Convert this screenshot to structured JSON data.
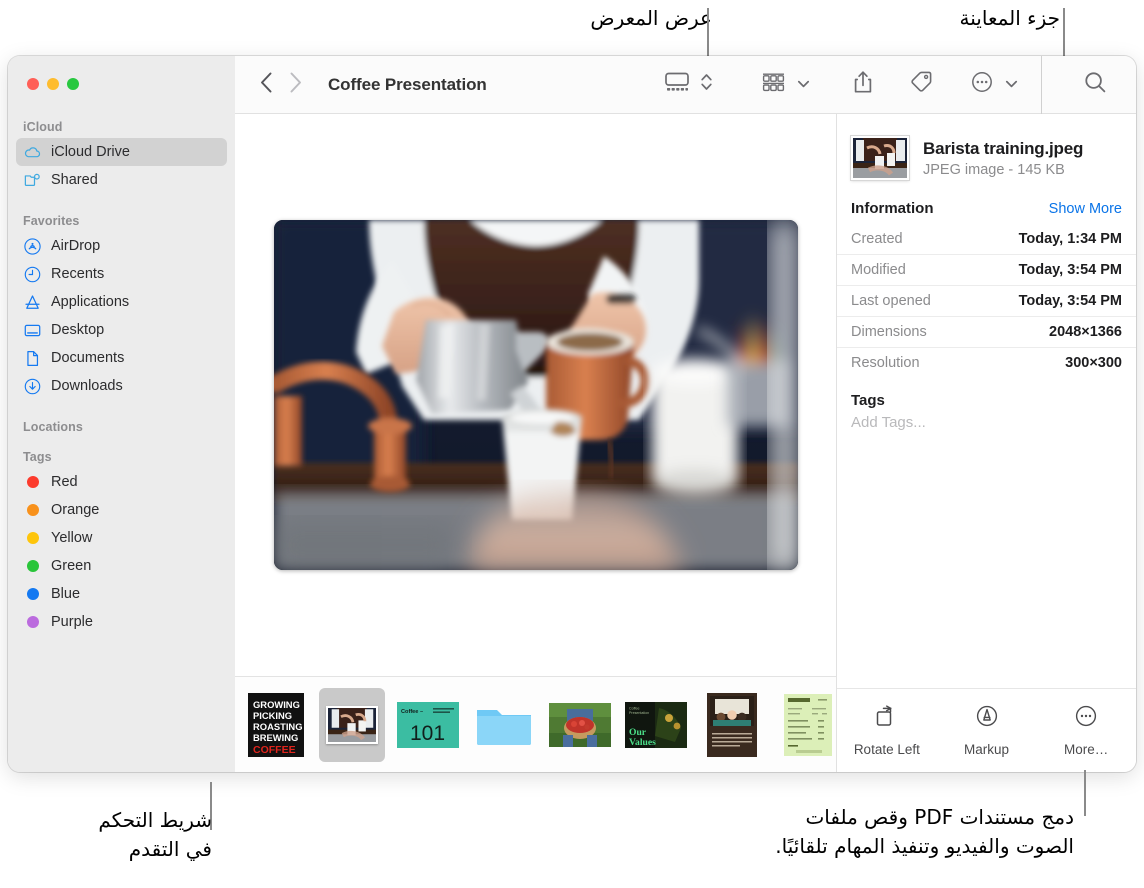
{
  "callouts": {
    "gallery_view": "عرض المعرض",
    "preview_pane": "جزء المعاينة",
    "scrubber_line1": "شريط التحكم",
    "scrubber_line2": "في التقدم",
    "bottom_right_line1": "دمج مستندات PDF وقص ملفات",
    "bottom_right_line2": "الصوت والفيديو وتنفيذ المهام تلقائيًا."
  },
  "window": {
    "traffic_lights": [
      {
        "name": "close",
        "color": "#FF5F57"
      },
      {
        "name": "minimize",
        "color": "#FEBC2E"
      },
      {
        "name": "zoom",
        "color": "#28C840"
      }
    ]
  },
  "toolbar": {
    "title": "Coffee Presentation",
    "back_icon": "chevron-left-icon",
    "forward_icon": "chevron-right-icon",
    "gallery_view_icon": "gallery-view-icon",
    "view_stepper_icon": "chevron-up-down-icon",
    "group_icon": "group-items-icon",
    "group_chevron_icon": "chevron-down-icon",
    "share_icon": "share-icon",
    "tag_icon": "tag-icon",
    "more_icon": "more-circle-icon",
    "more_chevron_icon": "chevron-down-icon",
    "search_icon": "search-icon"
  },
  "sidebar": {
    "sections": [
      {
        "header": "iCloud",
        "items": [
          {
            "label": "iCloud Drive",
            "icon": "icloud-icon",
            "selected": true
          },
          {
            "label": "Shared",
            "icon": "shared-folder-icon",
            "selected": false
          }
        ]
      },
      {
        "header": "Favorites",
        "items": [
          {
            "label": "AirDrop",
            "icon": "airdrop-icon",
            "selected": false
          },
          {
            "label": "Recents",
            "icon": "clock-icon",
            "selected": false
          },
          {
            "label": "Applications",
            "icon": "applications-icon",
            "selected": false
          },
          {
            "label": "Desktop",
            "icon": "desktop-icon",
            "selected": false
          },
          {
            "label": "Documents",
            "icon": "document-icon",
            "selected": false
          },
          {
            "label": "Downloads",
            "icon": "downloads-icon",
            "selected": false
          }
        ]
      },
      {
        "header": "Locations",
        "items": []
      },
      {
        "header": "Tags",
        "items": [
          {
            "label": "Red",
            "icon": "tag-dot-icon",
            "color": "#FC3B2D",
            "selected": false
          },
          {
            "label": "Orange",
            "icon": "tag-dot-icon",
            "color": "#F8911B",
            "selected": false
          },
          {
            "label": "Yellow",
            "icon": "tag-dot-icon",
            "color": "#FEC50B",
            "selected": false
          },
          {
            "label": "Green",
            "icon": "tag-dot-icon",
            "color": "#29CззА",
            "selected": false
          },
          {
            "label": "Blue",
            "icon": "tag-dot-icon",
            "color": "#1479F1",
            "selected": false
          },
          {
            "label": "Purple",
            "icon": "tag-dot-icon",
            "color": "#BB6BDE",
            "selected": false
          }
        ]
      }
    ]
  },
  "preview": {
    "alt": "Barista pouring coffee from a metal pitcher into a paper cup",
    "selected_index": 1
  },
  "filmstrip": {
    "items": [
      {
        "name": "coffee-poster-thumb",
        "kind": "poster",
        "selected": false,
        "lines": [
          "GROWING",
          "PICKING",
          "ROASTING",
          "BREWING"
        ],
        "accent_line": "COFFEE"
      },
      {
        "name": "barista-training-thumb",
        "kind": "photo",
        "selected": true
      },
      {
        "name": "coffee-101-slide-thumb",
        "kind": "slide101",
        "selected": false,
        "heading": "Coffee –",
        "big": "101"
      },
      {
        "name": "folder-thumb",
        "kind": "folder",
        "selected": false
      },
      {
        "name": "coffee-cherries-thumb",
        "kind": "cherries",
        "selected": false
      },
      {
        "name": "our-values-slide-thumb",
        "kind": "values",
        "selected": false,
        "title_line1": "Our",
        "title_line2": "Values"
      },
      {
        "name": "meeting-document-thumb",
        "kind": "doc",
        "selected": false
      },
      {
        "name": "produce-receipt-thumb",
        "kind": "receipt",
        "selected": false
      }
    ]
  },
  "info_panel": {
    "file_name": "Barista training.jpeg",
    "file_meta": "JPEG image - 145 KB",
    "section_title": "Information",
    "show_more": "Show More",
    "rows": [
      {
        "key": "Created",
        "value": "Today, 1:34 PM"
      },
      {
        "key": "Modified",
        "value": "Today, 3:54 PM"
      },
      {
        "key": "Last opened",
        "value": "Today, 3:54 PM"
      },
      {
        "key": "Dimensions",
        "value": "2048×1366"
      },
      {
        "key": "Resolution",
        "value": "300×300"
      }
    ],
    "tags_title": "Tags",
    "add_tags_placeholder": "Add Tags...",
    "actions": [
      {
        "label": "Rotate Left",
        "icon": "rotate-left-icon"
      },
      {
        "label": "Markup",
        "icon": "markup-icon"
      },
      {
        "label": "More…",
        "icon": "more-circle-icon"
      }
    ]
  },
  "colors": {
    "accent_blue": "#0a74e8",
    "sidebar_bg": "#ececec",
    "selection": "#d2d2d2"
  }
}
